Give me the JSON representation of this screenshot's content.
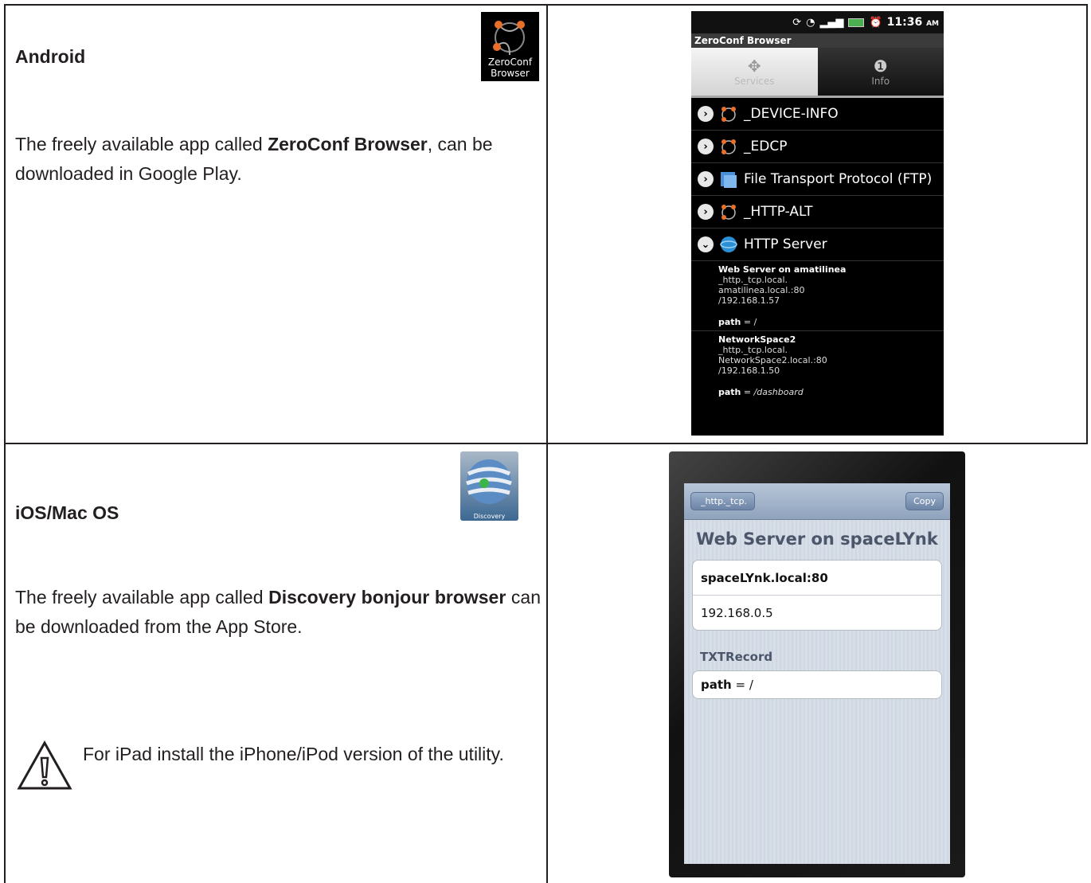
{
  "android": {
    "heading": "Android",
    "desc_pre": "The freely available app called ",
    "desc_bold": "ZeroConf Browser",
    "desc_post": ", can be downloaded in Google Play.",
    "icon_line1": "ZeroConf",
    "icon_line2": "Browser",
    "phone": {
      "clock": "11:36",
      "ampm": "AM",
      "app_title": "ZeroConf Browser",
      "tabs": [
        "Services",
        "Info"
      ],
      "services": [
        "_DEVICE-INFO",
        "_EDCP",
        "File Transport Protocol (FTP)",
        "_HTTP-ALT",
        "HTTP Server"
      ],
      "detail1": {
        "name": "Web Server on amatilinea",
        "type": "_http._tcp.local.",
        "host": "amatilinea.local.:80",
        "ip": "/192.168.1.57",
        "path_key": "path",
        "path_val": "= /"
      },
      "detail2": {
        "name": "NetworkSpace2",
        "type": "_http._tcp.local.",
        "host": "NetworkSpace2.local.:80",
        "ip": "/192.168.1.50",
        "path_key": "path",
        "path_val": "= /dashboard"
      }
    }
  },
  "ios": {
    "heading": "iOS/Mac OS",
    "desc_pre": "The freely available app called ",
    "desc_bold1": "Discovery bonjour",
    "desc_bold2": "browser",
    "desc_post": " can be downloaded from the App Store.",
    "warning": "For iPad install the iPhone/iPod version of the utility.",
    "icon_label": "Discovery",
    "phone": {
      "back_label": "_http._tcp.",
      "copy_label": "Copy",
      "title": "Web Server on spaceLYnk",
      "host": "spaceLYnk.local:80",
      "ip": "192.168.0.5",
      "section": "TXTRecord",
      "path_key": "path",
      "path_val": "= /"
    }
  }
}
